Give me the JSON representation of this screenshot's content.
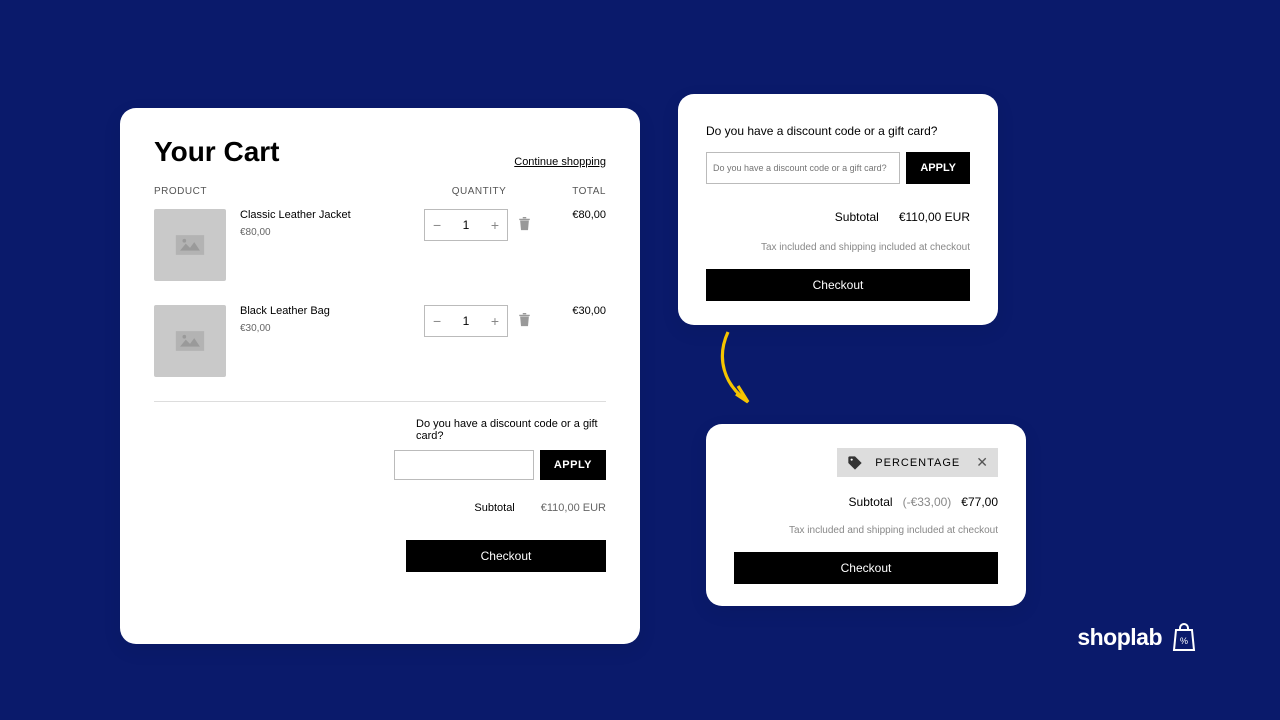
{
  "cart": {
    "title": "Your Cart",
    "continue_link": "Continue shopping",
    "columns": {
      "product": "PRODUCT",
      "quantity": "QUANTITY",
      "total": "TOTAL"
    },
    "items": [
      {
        "name": "Classic Leather Jacket",
        "price": "€80,00",
        "qty": "1",
        "line_total": "€80,00"
      },
      {
        "name": "Black Leather Bag",
        "price": "€30,00",
        "qty": "1",
        "line_total": "€30,00"
      }
    ],
    "discount_label": "Do you have a discount code or a gift card?",
    "apply": "APPLY",
    "subtotal_label": "Subtotal",
    "subtotal_value": "€110,00 EUR",
    "checkout": "Checkout"
  },
  "panel1": {
    "label": "Do you have a discount code or a gift card?",
    "placeholder": "Do you have a discount code or a gift card?",
    "apply": "APPLY",
    "subtotal_label": "Subtotal",
    "subtotal_value": "€110,00 EUR",
    "tax_note": "Tax included and shipping included at checkout",
    "checkout": "Checkout"
  },
  "panel2": {
    "code_name": "PERCENTAGE",
    "subtotal_label": "Subtotal",
    "discount_text": "(-€33,00)",
    "subtotal_value": "€77,00",
    "tax_note": "Tax included and shipping included at checkout",
    "checkout": "Checkout"
  },
  "brand": {
    "name": "shoplab"
  }
}
